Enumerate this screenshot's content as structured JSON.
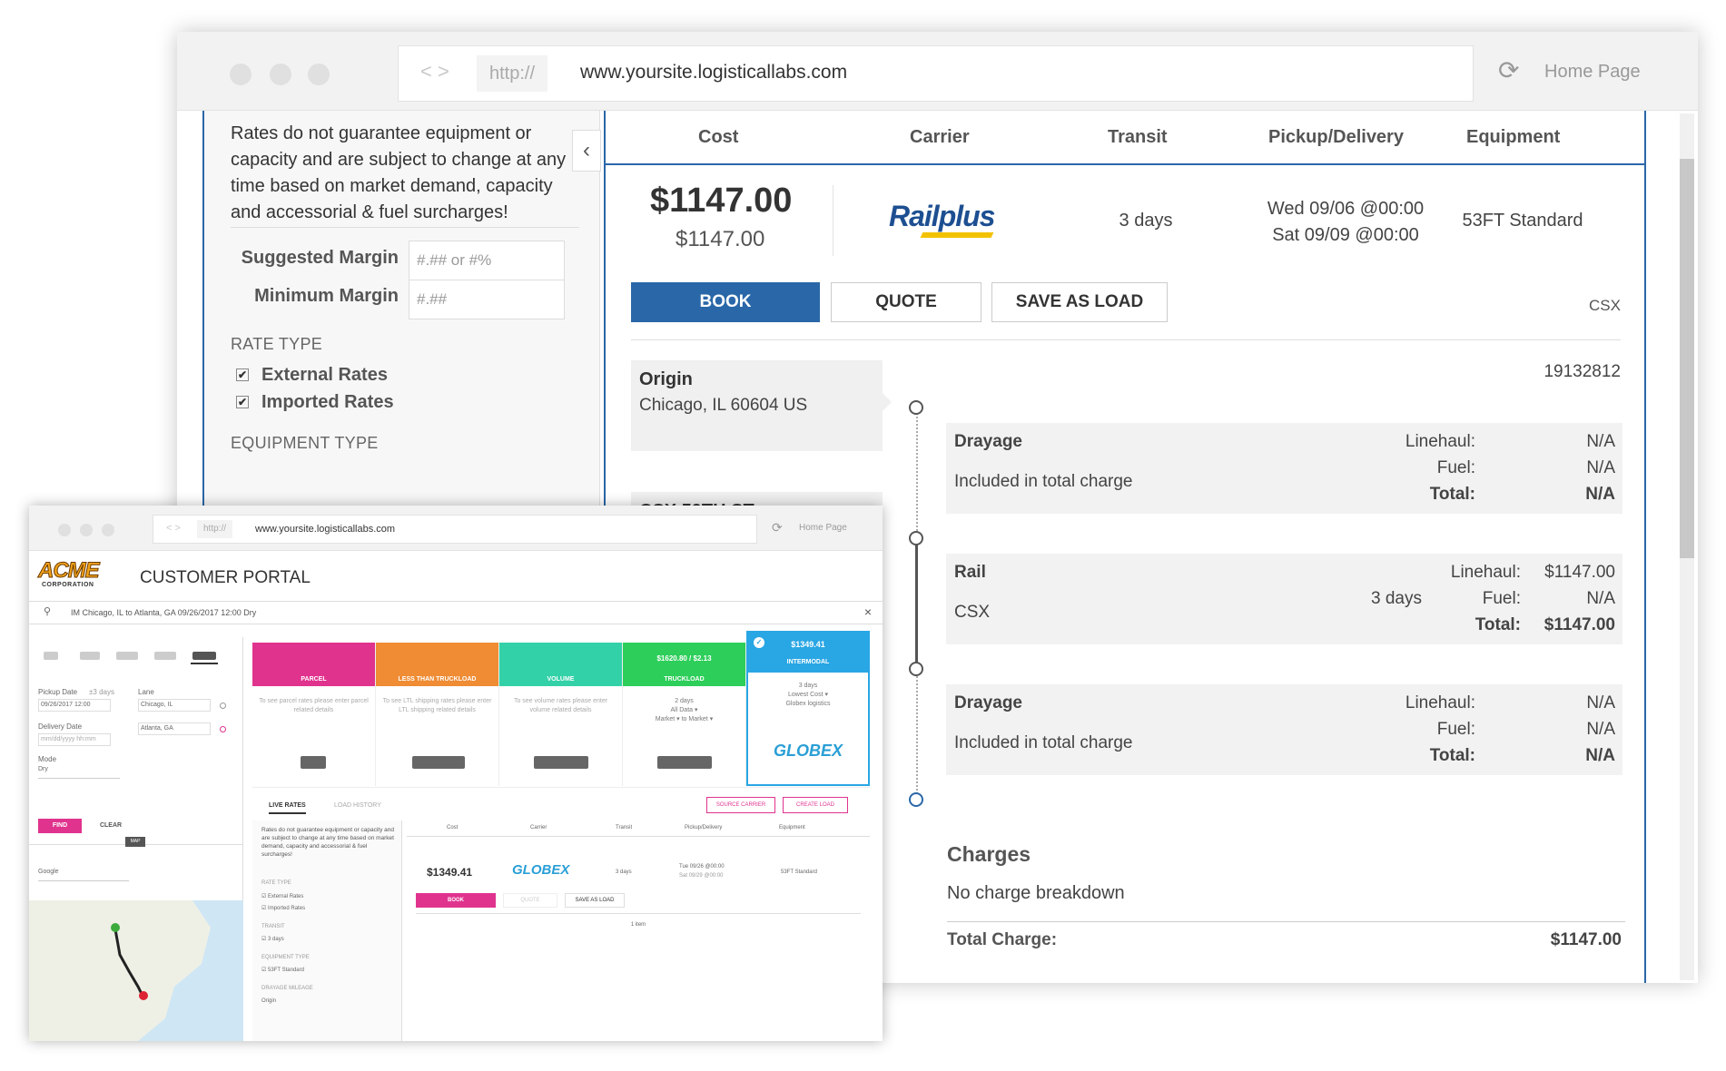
{
  "browser_main": {
    "nav_arrows": "< >",
    "protocol": "http://",
    "url": "www.yoursite.logisticallabs.com",
    "reload_icon": "⟳",
    "home_link": "Home Page"
  },
  "sidebar": {
    "notice": "Rates do not guarantee equipment or capacity and are subject to change at any time based on market demand, capacity and accessorial & fuel surcharges!",
    "suggested_margin_label": "Suggested Margin",
    "suggested_margin_placeholder": "#.## or #%",
    "minimum_margin_label": "Minimum Margin",
    "minimum_margin_placeholder": "#.##",
    "rate_type_title": "RATE TYPE",
    "rate_types": [
      {
        "label": "External Rates",
        "checked": true
      },
      {
        "label": "Imported Rates",
        "checked": true
      }
    ],
    "equipment_type_title": "EQUIPMENT TYPE",
    "collapse_icon": "‹"
  },
  "results": {
    "columns": [
      "Cost",
      "Carrier",
      "Transit",
      "Pickup/Delivery",
      "Equipment"
    ],
    "quote": {
      "cost": "$1147.00",
      "cost_sub": "$1147.00",
      "carrier_logo_text": "Rail",
      "carrier_logo_text2": "plus",
      "transit": "3 days",
      "pickup": "Wed 09/06 @00:00",
      "delivery": "Sat 09/09 @00:00",
      "equipment": "53FT Standard",
      "book_label": "BOOK",
      "quote_label": "QUOTE",
      "save_label": "SAVE AS LOAD",
      "scac": "CSX",
      "ref": "19132812"
    },
    "origin": {
      "title": "Origin",
      "address": "Chicago, IL 60604 US"
    },
    "next_stop_partial": "CSX 59TH ST",
    "segments": [
      {
        "title": "Drayage",
        "sub": "Included in total charge",
        "transit": "",
        "linehaul_label": "Linehaul:",
        "linehaul": "N/A",
        "fuel_label": "Fuel:",
        "fuel": "N/A",
        "total_label": "Total:",
        "total": "N/A"
      },
      {
        "title": "Rail",
        "sub": "CSX",
        "transit": "3 days",
        "linehaul_label": "Linehaul:",
        "linehaul": "$1147.00",
        "fuel_label": "Fuel:",
        "fuel": "N/A",
        "total_label": "Total:",
        "total": "$1147.00"
      },
      {
        "title": "Drayage",
        "sub": "Included in total charge",
        "transit": "",
        "linehaul_label": "Linehaul:",
        "linehaul": "N/A",
        "fuel_label": "Fuel:",
        "fuel": "N/A",
        "total_label": "Total:",
        "total": "N/A"
      }
    ],
    "charges_title": "Charges",
    "charges_note": "No charge breakdown",
    "total_label": "Total Charge:",
    "total_value": "$1147.00"
  },
  "browser_small": {
    "nav_arrows": "< >",
    "protocol": "http://",
    "url": "www.yoursite.logisticallabs.com",
    "reload_icon": "⟳",
    "home_link": "Home Page"
  },
  "portal": {
    "logo_top": "ACME",
    "logo_bottom": "CORPORATION",
    "title": "CUSTOMER PORTAL",
    "search_text": "IM Chicago, IL to Atlanta, GA 09/26/2017 12:00 Dry",
    "close_icon": "×",
    "pickup_label": "Pickup Date",
    "pickup_value": "09/26/2017 12:00",
    "pickup_hint": "±3 days",
    "lane_label": "Lane",
    "lane_from": "Chicago, IL",
    "lane_to": "Atlanta, GA",
    "delivery_label": "Delivery Date",
    "delivery_placeholder": "mm/dd/yyyy hh:mm",
    "mode_label": "Mode",
    "mode_value": "Dry",
    "find_label": "FIND",
    "clear_label": "CLEAR",
    "map_label": "MAP",
    "map_select": "Google",
    "modes": [
      {
        "label": "PARCEL",
        "color": "#e0338e",
        "text": "To see parcel rates please enter parcel related details"
      },
      {
        "label": "LESS THAN TRUCKLOAD",
        "color": "#ef8c34",
        "text": "To see LTL shipping rates please enter LTL shipping related details"
      },
      {
        "label": "VOLUME",
        "color": "#33d1a8",
        "text": "To see volume rates please enter volume related details"
      },
      {
        "label": "TRUCKLOAD",
        "price": "$1620.80 / $2.13",
        "color": "#2dce5a",
        "text": "2 days\nAll Data ▾\nMarket ▾ to Market ▾"
      },
      {
        "label": "INTERMODAL",
        "price": "$1349.41",
        "color": "#29a6e4",
        "text": "3 days\nLowest Cost ▾\nGlobex logistics"
      }
    ],
    "tabs": [
      "LIVE RATES",
      "LOAD HISTORY"
    ],
    "source_carrier": "SOURCE CARRIER",
    "create_load": "CREATE LOAD",
    "notice": "Rates do not guarantee equipment or capacity and are subject to change at any time based on market demand, capacity and accessorial & fuel surcharges!",
    "rate_type_title": "RATE TYPE",
    "rate_types": [
      "External Rates",
      "Imported Rates"
    ],
    "transit_title": "TRANSIT",
    "transit_value": "3 days",
    "equipment_title": "EQUIPMENT TYPE",
    "equipment_value": "53FT Standard",
    "drayage_title": "DRAYAGE MILEAGE",
    "drayage_origin": "Origin",
    "table_cols": [
      "Cost",
      "Carrier",
      "Transit",
      "Pickup/Delivery",
      "Equipment"
    ],
    "row": {
      "cost": "$1349.41",
      "carrier": "GLOBEX",
      "transit": "3 days",
      "pickup": "Tue 09/26 @00:00",
      "delivery": "Sat 09/29 @00:00",
      "equipment": "53FT Standard"
    },
    "book_label": "BOOK",
    "quote_label": "QUOTE",
    "save_label": "SAVE AS LOAD",
    "item_count": "1 item",
    "globex": "GLOBEX"
  },
  "colors": {
    "accent": "#2a67a8",
    "pink": "#e0338e"
  }
}
